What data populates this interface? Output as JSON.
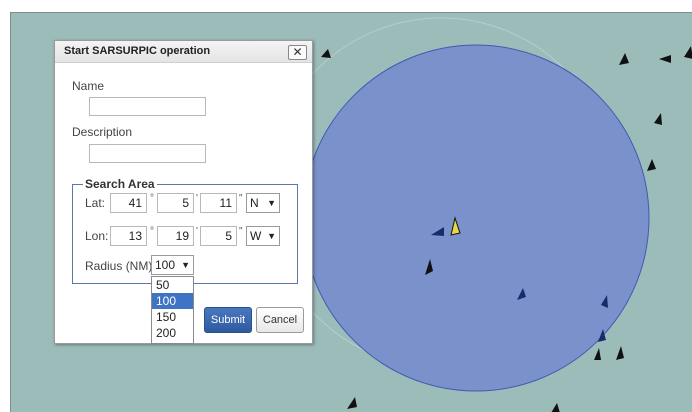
{
  "dialog": {
    "title": "Start SARSURPIC operation",
    "close_glyph": "✕",
    "name_label": "Name",
    "name_value": "",
    "description_label": "Description",
    "description_value": "",
    "search_area": {
      "legend": "Search Area",
      "lat_label": "Lat:",
      "lat_deg": "41",
      "lat_min": "5",
      "lat_sec": "11",
      "lat_hemi": "N",
      "lon_label": "Lon:",
      "lon_deg": "13",
      "lon_min": "19",
      "lon_sec": "5",
      "lon_hemi": "W",
      "deg_symbol": "°",
      "min_symbol": "'",
      "sec_symbol": "\"",
      "radius_label": "Radius (NM)",
      "radius_value": "100",
      "radius_options": [
        "50",
        "100",
        "150",
        "200"
      ]
    },
    "submit_label": "Submit",
    "cancel_label": "Cancel"
  },
  "colors": {
    "map_background": "#9cbcba",
    "search_circle_fill": "#7b91cc",
    "search_circle_stroke": "#3f5bb0",
    "submit_button": "#3a66b0",
    "selected_option": "#3f74c4"
  },
  "icons": {
    "vessel_marker": "vessel-icon",
    "dropdown_arrow": "▼"
  }
}
